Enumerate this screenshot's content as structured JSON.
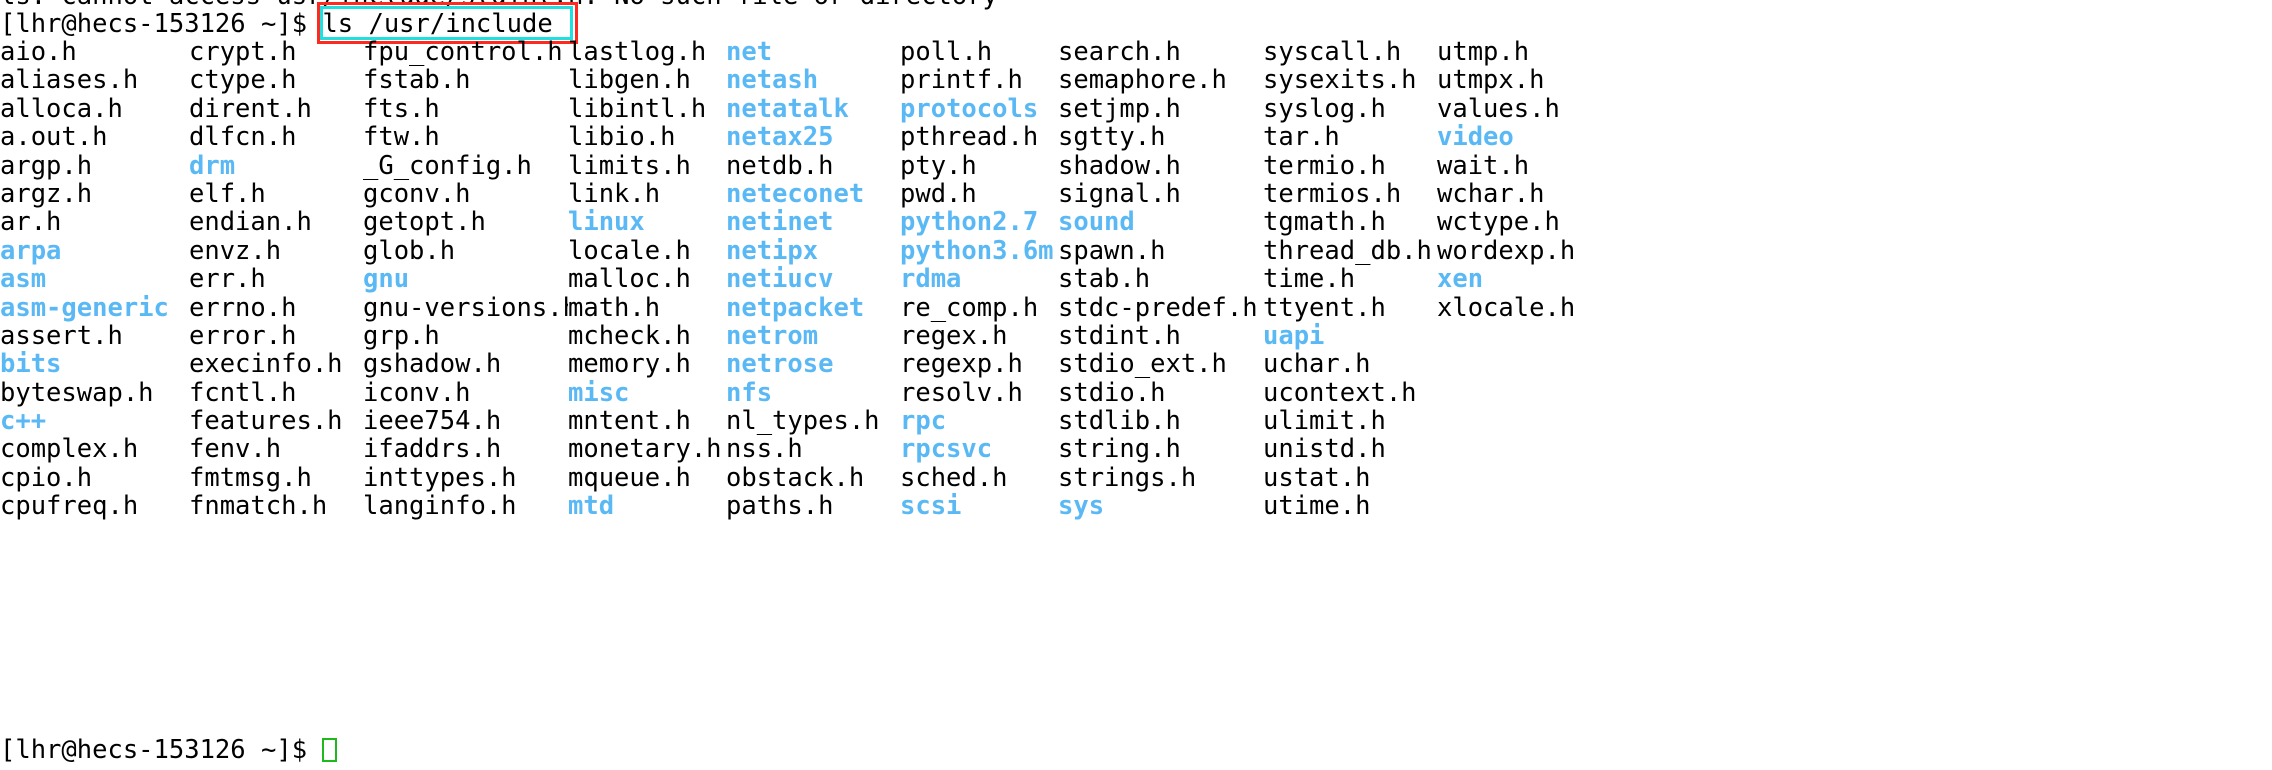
{
  "terminal": {
    "background_color": "#ffffff",
    "foreground_color": "#000000",
    "directory_color": "#5ab9f5",
    "highlight_box_color": "#ff2a1f",
    "selection_box_color": "#1fe0e0",
    "cursor_color": "#1db91d",
    "error_line": "ls: cannot access usr/include/stdint.h: No such file or directory",
    "prompt": "[lhr@hecs-153126 ~]$ ",
    "command": "ls /usr/include",
    "final_prompt": "[lhr@hecs-153126 ~]$ ",
    "columns": 9,
    "rows": [
      [
        {
          "name": "aio.h",
          "type": "file"
        },
        {
          "name": "crypt.h",
          "type": "file"
        },
        {
          "name": "fpu_control.h",
          "type": "file"
        },
        {
          "name": "lastlog.h",
          "type": "file"
        },
        {
          "name": "net",
          "type": "dir"
        },
        {
          "name": "poll.h",
          "type": "file"
        },
        {
          "name": "search.h",
          "type": "file"
        },
        {
          "name": "syscall.h",
          "type": "file"
        },
        {
          "name": "utmp.h",
          "type": "file"
        }
      ],
      [
        {
          "name": "aliases.h",
          "type": "file"
        },
        {
          "name": "ctype.h",
          "type": "file"
        },
        {
          "name": "fstab.h",
          "type": "file"
        },
        {
          "name": "libgen.h",
          "type": "file"
        },
        {
          "name": "netash",
          "type": "dir"
        },
        {
          "name": "printf.h",
          "type": "file"
        },
        {
          "name": "semaphore.h",
          "type": "file"
        },
        {
          "name": "sysexits.h",
          "type": "file"
        },
        {
          "name": "utmpx.h",
          "type": "file"
        }
      ],
      [
        {
          "name": "alloca.h",
          "type": "file"
        },
        {
          "name": "dirent.h",
          "type": "file"
        },
        {
          "name": "fts.h",
          "type": "file"
        },
        {
          "name": "libintl.h",
          "type": "file"
        },
        {
          "name": "netatalk",
          "type": "dir"
        },
        {
          "name": "protocols",
          "type": "dir"
        },
        {
          "name": "setjmp.h",
          "type": "file"
        },
        {
          "name": "syslog.h",
          "type": "file"
        },
        {
          "name": "values.h",
          "type": "file"
        }
      ],
      [
        {
          "name": "a.out.h",
          "type": "file"
        },
        {
          "name": "dlfcn.h",
          "type": "file"
        },
        {
          "name": "ftw.h",
          "type": "file"
        },
        {
          "name": "libio.h",
          "type": "file"
        },
        {
          "name": "netax25",
          "type": "dir"
        },
        {
          "name": "pthread.h",
          "type": "file"
        },
        {
          "name": "sgtty.h",
          "type": "file"
        },
        {
          "name": "tar.h",
          "type": "file"
        },
        {
          "name": "video",
          "type": "dir"
        }
      ],
      [
        {
          "name": "argp.h",
          "type": "file"
        },
        {
          "name": "drm",
          "type": "dir"
        },
        {
          "name": "_G_config.h",
          "type": "file"
        },
        {
          "name": "limits.h",
          "type": "file"
        },
        {
          "name": "netdb.h",
          "type": "file"
        },
        {
          "name": "pty.h",
          "type": "file"
        },
        {
          "name": "shadow.h",
          "type": "file"
        },
        {
          "name": "termio.h",
          "type": "file"
        },
        {
          "name": "wait.h",
          "type": "file"
        }
      ],
      [
        {
          "name": "argz.h",
          "type": "file"
        },
        {
          "name": "elf.h",
          "type": "file"
        },
        {
          "name": "gconv.h",
          "type": "file"
        },
        {
          "name": "link.h",
          "type": "file"
        },
        {
          "name": "neteconet",
          "type": "dir"
        },
        {
          "name": "pwd.h",
          "type": "file"
        },
        {
          "name": "signal.h",
          "type": "file"
        },
        {
          "name": "termios.h",
          "type": "file"
        },
        {
          "name": "wchar.h",
          "type": "file"
        }
      ],
      [
        {
          "name": "ar.h",
          "type": "file"
        },
        {
          "name": "endian.h",
          "type": "file"
        },
        {
          "name": "getopt.h",
          "type": "file"
        },
        {
          "name": "linux",
          "type": "dir"
        },
        {
          "name": "netinet",
          "type": "dir"
        },
        {
          "name": "python2.7",
          "type": "dir"
        },
        {
          "name": "sound",
          "type": "dir"
        },
        {
          "name": "tgmath.h",
          "type": "file"
        },
        {
          "name": "wctype.h",
          "type": "file"
        }
      ],
      [
        {
          "name": "arpa",
          "type": "dir"
        },
        {
          "name": "envz.h",
          "type": "file"
        },
        {
          "name": "glob.h",
          "type": "file"
        },
        {
          "name": "locale.h",
          "type": "file"
        },
        {
          "name": "netipx",
          "type": "dir"
        },
        {
          "name": "python3.6m",
          "type": "dir"
        },
        {
          "name": "spawn.h",
          "type": "file"
        },
        {
          "name": "thread_db.h",
          "type": "file"
        },
        {
          "name": "wordexp.h",
          "type": "file"
        }
      ],
      [
        {
          "name": "asm",
          "type": "dir"
        },
        {
          "name": "err.h",
          "type": "file"
        },
        {
          "name": "gnu",
          "type": "dir"
        },
        {
          "name": "malloc.h",
          "type": "file"
        },
        {
          "name": "netiucv",
          "type": "dir"
        },
        {
          "name": "rdma",
          "type": "dir"
        },
        {
          "name": "stab.h",
          "type": "file"
        },
        {
          "name": "time.h",
          "type": "file"
        },
        {
          "name": "xen",
          "type": "dir"
        }
      ],
      [
        {
          "name": "asm-generic",
          "type": "dir"
        },
        {
          "name": "errno.h",
          "type": "file"
        },
        {
          "name": "gnu-versions.h",
          "type": "file"
        },
        {
          "name": "math.h",
          "type": "file"
        },
        {
          "name": "netpacket",
          "type": "dir"
        },
        {
          "name": "re_comp.h",
          "type": "file"
        },
        {
          "name": "stdc-predef.h",
          "type": "file"
        },
        {
          "name": "ttyent.h",
          "type": "file"
        },
        {
          "name": "xlocale.h",
          "type": "file"
        }
      ],
      [
        {
          "name": "assert.h",
          "type": "file"
        },
        {
          "name": "error.h",
          "type": "file"
        },
        {
          "name": "grp.h",
          "type": "file"
        },
        {
          "name": "mcheck.h",
          "type": "file"
        },
        {
          "name": "netrom",
          "type": "dir"
        },
        {
          "name": "regex.h",
          "type": "file"
        },
        {
          "name": "stdint.h",
          "type": "file"
        },
        {
          "name": "uapi",
          "type": "dir"
        },
        {
          "name": "",
          "type": "file"
        }
      ],
      [
        {
          "name": "bits",
          "type": "dir"
        },
        {
          "name": "execinfo.h",
          "type": "file"
        },
        {
          "name": "gshadow.h",
          "type": "file"
        },
        {
          "name": "memory.h",
          "type": "file"
        },
        {
          "name": "netrose",
          "type": "dir"
        },
        {
          "name": "regexp.h",
          "type": "file"
        },
        {
          "name": "stdio_ext.h",
          "type": "file"
        },
        {
          "name": "uchar.h",
          "type": "file"
        },
        {
          "name": "",
          "type": "file"
        }
      ],
      [
        {
          "name": "byteswap.h",
          "type": "file"
        },
        {
          "name": "fcntl.h",
          "type": "file"
        },
        {
          "name": "iconv.h",
          "type": "file"
        },
        {
          "name": "misc",
          "type": "dir"
        },
        {
          "name": "nfs",
          "type": "dir"
        },
        {
          "name": "resolv.h",
          "type": "file"
        },
        {
          "name": "stdio.h",
          "type": "file"
        },
        {
          "name": "ucontext.h",
          "type": "file"
        },
        {
          "name": "",
          "type": "file"
        }
      ],
      [
        {
          "name": "c++",
          "type": "dir"
        },
        {
          "name": "features.h",
          "type": "file"
        },
        {
          "name": "ieee754.h",
          "type": "file"
        },
        {
          "name": "mntent.h",
          "type": "file"
        },
        {
          "name": "nl_types.h",
          "type": "file"
        },
        {
          "name": "rpc",
          "type": "dir"
        },
        {
          "name": "stdlib.h",
          "type": "file"
        },
        {
          "name": "ulimit.h",
          "type": "file"
        },
        {
          "name": "",
          "type": "file"
        }
      ],
      [
        {
          "name": "complex.h",
          "type": "file"
        },
        {
          "name": "fenv.h",
          "type": "file"
        },
        {
          "name": "ifaddrs.h",
          "type": "file"
        },
        {
          "name": "monetary.h",
          "type": "file"
        },
        {
          "name": "nss.h",
          "type": "file"
        },
        {
          "name": "rpcsvc",
          "type": "dir"
        },
        {
          "name": "string.h",
          "type": "file"
        },
        {
          "name": "unistd.h",
          "type": "file"
        },
        {
          "name": "",
          "type": "file"
        }
      ],
      [
        {
          "name": "cpio.h",
          "type": "file"
        },
        {
          "name": "fmtmsg.h",
          "type": "file"
        },
        {
          "name": "inttypes.h",
          "type": "file"
        },
        {
          "name": "mqueue.h",
          "type": "file"
        },
        {
          "name": "obstack.h",
          "type": "file"
        },
        {
          "name": "sched.h",
          "type": "file"
        },
        {
          "name": "strings.h",
          "type": "file"
        },
        {
          "name": "ustat.h",
          "type": "file"
        },
        {
          "name": "",
          "type": "file"
        }
      ],
      [
        {
          "name": "cpufreq.h",
          "type": "file"
        },
        {
          "name": "fnmatch.h",
          "type": "file"
        },
        {
          "name": "langinfo.h",
          "type": "file"
        },
        {
          "name": "mtd",
          "type": "dir"
        },
        {
          "name": "paths.h",
          "type": "file"
        },
        {
          "name": "scsi",
          "type": "dir"
        },
        {
          "name": "sys",
          "type": "dir"
        },
        {
          "name": "utime.h",
          "type": "file"
        },
        {
          "name": "",
          "type": "file"
        }
      ]
    ]
  }
}
